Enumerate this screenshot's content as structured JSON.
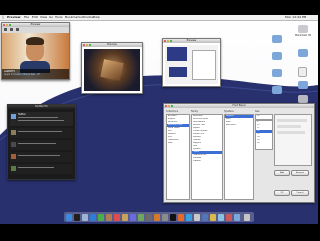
{
  "menubar": {
    "app_name": "Preview",
    "items": [
      "File",
      "Edit",
      "View",
      "Go",
      "Tools",
      "Bookmarks",
      "Window",
      "Help"
    ],
    "clock": "Mon 12:44 PM"
  },
  "video_window": {
    "title": "Preview",
    "caption_line1": "AskBillTV",
    "caption_line2": "Apple Innovation Meme Test - AT"
  },
  "photo_window": {
    "title": "Preview"
  },
  "screenshot_window": {
    "title": "Preview"
  },
  "chat_window": {
    "title": "Twitterrific",
    "user": "Twitter"
  },
  "font_panel": {
    "title": "Font Panel",
    "col1_header": "Collections",
    "col2_header": "Family",
    "col3_header": "Typeface",
    "col4_header": "Size",
    "collections": [
      "All Fonts",
      "English",
      "Favorites",
      "Recently Used",
      "Fixed Width",
      "Fun",
      "Modern",
      "PDF",
      "Traditional",
      "Web"
    ],
    "families": [
      "Helvetica",
      "Helvetica Neue",
      "Herculanum",
      "Hoefler Text",
      "Impact",
      "Lucida Grande",
      "Marker Felt",
      "Monaco",
      "Optima",
      "Papyrus",
      "Skia",
      "Symbol",
      "Times",
      "Trebuchet MS",
      "Verdana",
      "Zapfino"
    ],
    "typefaces": [
      "Regular",
      "Italic",
      "Bold",
      "Bold Italic"
    ],
    "sizes": [
      "9",
      "10",
      "11",
      "12",
      "13",
      "14",
      "18",
      "24"
    ],
    "size_value": "12",
    "buttons": [
      "Add",
      "Remove",
      "OK",
      "Cancel"
    ]
  },
  "desktop_icons": [
    "Macintosh HD",
    "Documents",
    "Pictures",
    "Music",
    "Movies",
    "Applications",
    "Downloads"
  ],
  "colors": {
    "swoosh": "#28306e",
    "selection": "#3b6fd6"
  }
}
